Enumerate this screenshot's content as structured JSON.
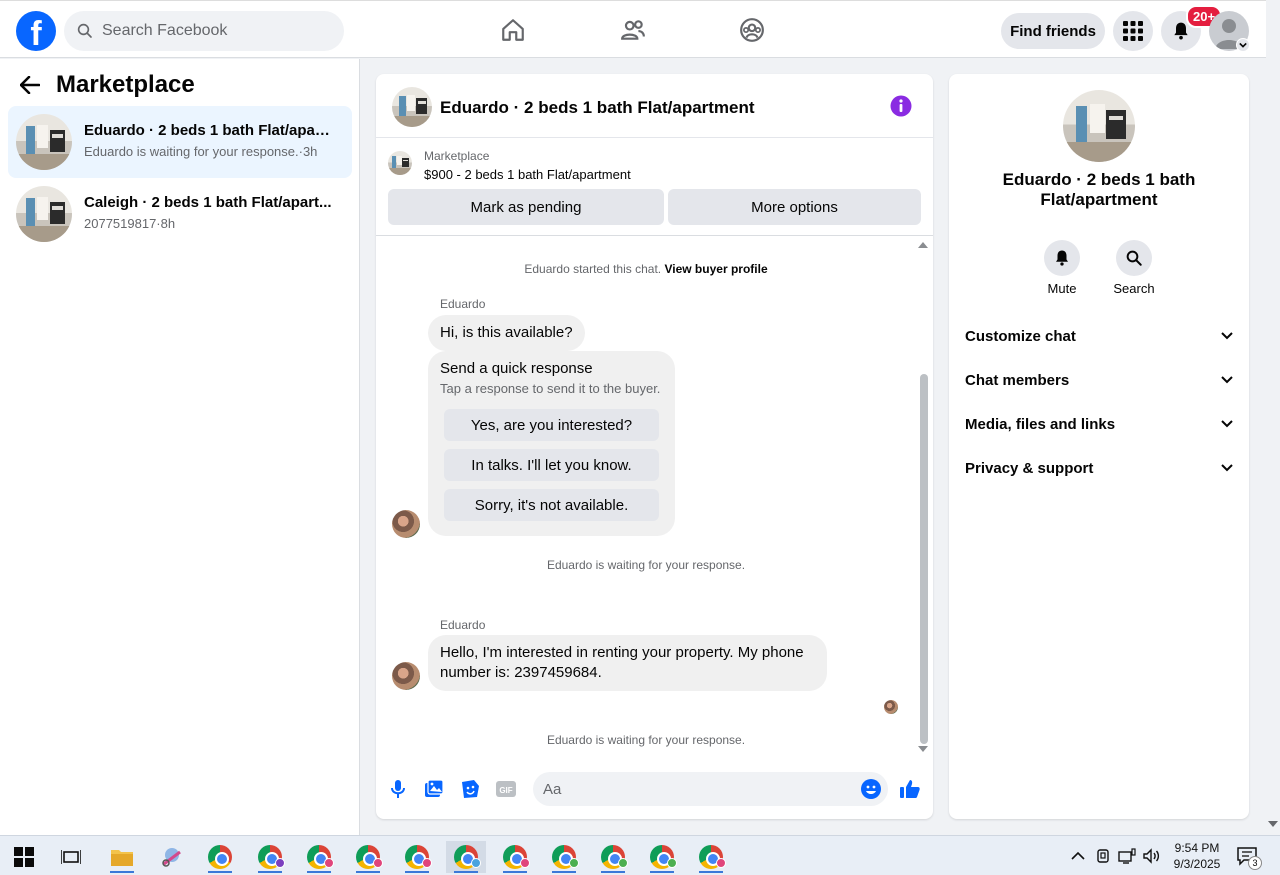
{
  "topbar": {
    "search_placeholder": "Search Facebook",
    "find_friends": "Find friends",
    "notification_badge": "20+",
    "colors": {
      "brand": "#0866ff",
      "badge": "#e41e3f"
    }
  },
  "sidebar": {
    "title": "Marketplace",
    "conversations": [
      {
        "title": "Eduardo · 2 beds 1 bath Flat/apart...",
        "subtitle": "Eduardo is waiting for your response.·3h",
        "active": true
      },
      {
        "title": "Caleigh · 2 beds 1 bath Flat/apart...",
        "subtitle": "2077519817·8h",
        "active": false
      }
    ]
  },
  "chat": {
    "title": "Eduardo · 2 beds 1 bath Flat/apartment",
    "listing_source": "Marketplace",
    "listing_price": "$900 - 2 beds 1 bath Flat/apartment",
    "mark_pending": "Mark as pending",
    "more_options": "More options",
    "started_text": "Eduardo started this chat.",
    "view_buyer_profile": "View buyer profile",
    "sender_1": "Eduardo",
    "message_1": "Hi, is this available?",
    "quick_title": "Send a quick response",
    "quick_subtitle": "Tap a response to send it to the buyer.",
    "quick_responses": [
      "Yes, are you interested?",
      "In talks. I'll let you know.",
      "Sorry, it's not available."
    ],
    "waiting_1": "Eduardo is waiting for your response.",
    "sender_2": "Eduardo",
    "message_2_line1": "Hello, I'm interested in renting your property. My phone",
    "message_2_line2": "number is: 2397459684.",
    "waiting_2": "Eduardo is waiting for your response.",
    "composer_placeholder": "Aa"
  },
  "info_panel": {
    "title_line1": "Eduardo · 2 beds 1 bath",
    "title_line2": "Flat/apartment",
    "mute": "Mute",
    "search": "Search",
    "sections": [
      "Customize chat",
      "Chat members",
      "Media, files and links",
      "Privacy & support"
    ]
  },
  "taskbar": {
    "time": "9:54 PM",
    "date": "9/3/2025",
    "notification_count": "3",
    "chrome_profile_colors": [
      "#7b3fbf",
      "#e0457b",
      "#e0457b",
      "#e0457b",
      "#4aa3df",
      "#e0457b",
      "#4caf50",
      "#4caf50",
      "#4caf50",
      "#e0457b"
    ]
  }
}
